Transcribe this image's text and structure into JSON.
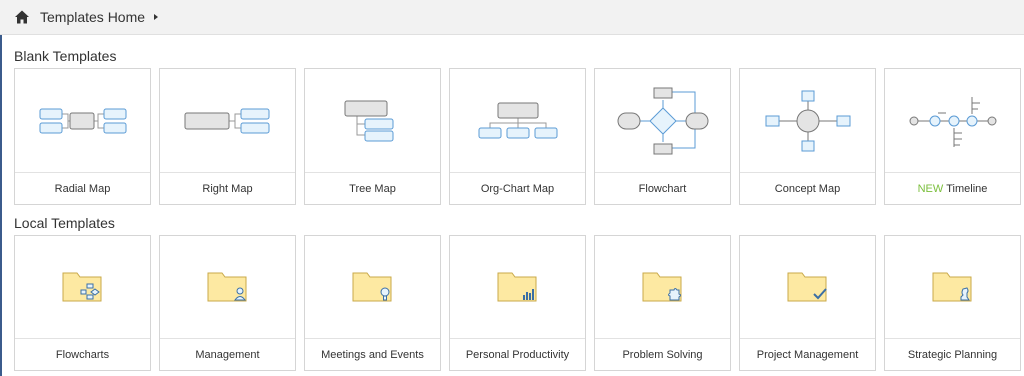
{
  "header": {
    "breadcrumb": "Templates Home",
    "home_icon": "home-icon",
    "caret_icon": "caret-right-icon"
  },
  "blank": {
    "title": "Blank Templates",
    "items": [
      {
        "label": "Radial Map",
        "icon": "radial-map-icon"
      },
      {
        "label": "Right Map",
        "icon": "right-map-icon"
      },
      {
        "label": "Tree Map",
        "icon": "tree-map-icon"
      },
      {
        "label": "Org-Chart Map",
        "icon": "org-chart-icon"
      },
      {
        "label": "Flowchart",
        "icon": "flowchart-icon"
      },
      {
        "label": "Concept Map",
        "icon": "concept-map-icon"
      },
      {
        "badge": "NEW",
        "label": "Timeline",
        "icon": "timeline-icon"
      }
    ]
  },
  "local": {
    "title": "Local Templates",
    "items": [
      {
        "label": "Flowcharts",
        "icon": "folder-flowchart-icon"
      },
      {
        "label": "Management",
        "icon": "folder-person-icon"
      },
      {
        "label": "Meetings and Events",
        "icon": "folder-bulb-icon"
      },
      {
        "label": "Personal Productivity",
        "icon": "folder-chart-icon"
      },
      {
        "label": "Problem Solving",
        "icon": "folder-puzzle-icon"
      },
      {
        "label": "Project Management",
        "icon": "folder-check-icon"
      },
      {
        "label": "Strategic Planning",
        "icon": "folder-chess-icon"
      }
    ]
  },
  "colors": {
    "node_fill": "#e6f3fc",
    "node_stroke": "#5b9bd5",
    "central_fill": "#e4e4e4",
    "folder_fill": "#fde9a2",
    "folder_stroke": "#c9a94a",
    "new_badge": "#7bbf3c"
  }
}
